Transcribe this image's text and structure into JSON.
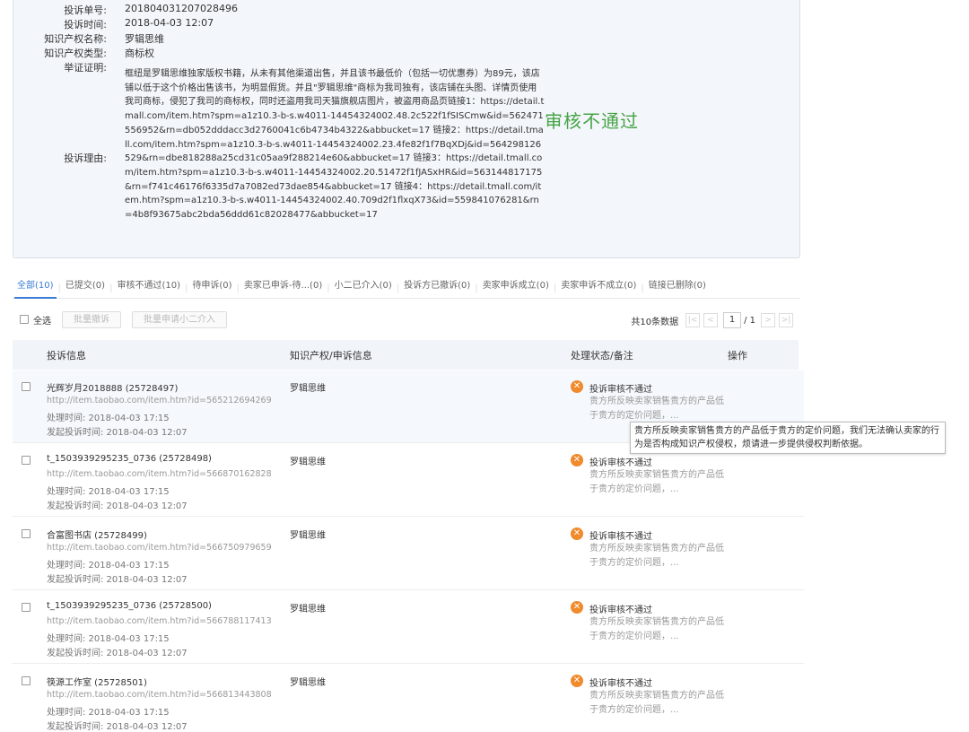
{
  "complaint": {
    "id_label": "投诉单号:",
    "id_value": "201804031207028496",
    "time_label": "投诉时间:",
    "time_value": "2018-04-03 12:07",
    "ip_name_label": "知识产权名称:",
    "ip_name_value": "罗辑思维",
    "ip_type_label": "知识产权类型:",
    "ip_type_value": "商标权",
    "evidence_label": "举证证明:",
    "reason_label": "投诉理由:",
    "reason_text": "框纽是罗辑思维独家版权书籍，从未有其他渠道出售，并且该书最低价（包括一切优惠券）为89元，该店铺以低于这个价格出售该书，为明显假货。并且\"罗辑思维\"商标为我司独有，该店铺在头图、详情页使用我司商标，侵犯了我司的商标权，同时还盗用我司天猫旗舰店图片，被盗用商品页链接1：https://detail.tmall.com/item.htm?spm=a1z10.3-b-s.w4011-14454324002.48.2c522f1fSISCmw&id=562471556952&rn=db052dddacc3d2760041c6b4734b4322&abbucket=17 链接2：https://detail.tmall.com/item.htm?spm=a1z10.3-b-s.w4011-14454324002.23.4fe82f1f7BqXDj&id=564298126529&rn=dbe818288a25cd31c05aa9f288214e60&abbucket=17 链接3：https://detail.tmall.com/item.htm?spm=a1z10.3-b-s.w4011-14454324002.20.51472f1fJASxHR&id=563144817175&rn=f741c46176f6335d7a7082ed73dae854&abbucket=17 链接4：https://detail.tmall.com/item.htm?spm=a1z10.3-b-s.w4011-14454324002.40.709d2f1flxqX73&id=559841076281&rn=4b8f93675abc2bda56ddd61c82028477&abbucket=17",
    "stamp": "审核不通过"
  },
  "tabs": [
    {
      "label": "全部(10)",
      "active": true
    },
    {
      "label": "已提交(0)"
    },
    {
      "label": "审核不通过(10)"
    },
    {
      "label": "待申诉(0)"
    },
    {
      "label": "卖家已申诉-待...(0)"
    },
    {
      "label": "小二已介入(0)"
    },
    {
      "label": "投诉方已撤诉(0)"
    },
    {
      "label": "卖家申诉成立(0)"
    },
    {
      "label": "卖家申诉不成立(0)"
    },
    {
      "label": "链接已删除(0)"
    }
  ],
  "toolbar": {
    "select_all": "全选",
    "batch_withdraw": "批量撤诉",
    "batch_request": "批量申请小二介入"
  },
  "pager": {
    "total_text": "共10条数据",
    "first": "|<",
    "prev": "<",
    "current": "1",
    "total_pages": "/ 1",
    "next": ">",
    "last": ">|"
  },
  "table": {
    "headers": [
      "投诉信息",
      "知识产权/申诉信息",
      "处理状态/备注",
      "操作"
    ],
    "rows": [
      {
        "store": "光辉岁月2018888 (25728497)",
        "url": "http://item.taobao.com/item.htm?id=565212694269",
        "handled": "处理时间:  2018-04-03 17:15",
        "filed": "发起投诉时间:  2018-04-03 12:07",
        "ip": "罗辑思维",
        "status": "投诉审核不通过",
        "note": "贵方所反映卖家销售贵方的产品低于贵方的定价问题，..."
      },
      {
        "store": "t_1503939295235_0736 (25728498)",
        "url": "http://item.taobao.com/item.htm?id=566870162828",
        "handled": "处理时间:  2018-04-03 17:15",
        "filed": "发起投诉时间:  2018-04-03 12:07",
        "ip": "罗辑思维",
        "status": "投诉审核不通过",
        "note": "贵方所反映卖家销售贵方的产品低于贵方的定价问题，..."
      },
      {
        "store": "合富图书店 (25728499)",
        "url": "http://item.taobao.com/item.htm?id=566750979659",
        "handled": "处理时间:  2018-04-03 17:15",
        "filed": "发起投诉时间:  2018-04-03 12:07",
        "ip": "罗辑思维",
        "status": "投诉审核不通过",
        "note": "贵方所反映卖家销售贵方的产品低于贵方的定价问题，..."
      },
      {
        "store": "t_1503939295235_0736 (25728500)",
        "url": "http://item.taobao.com/item.htm?id=566788117413",
        "handled": "处理时间:  2018-04-03 17:15",
        "filed": "发起投诉时间:  2018-04-03 12:07",
        "ip": "罗辑思维",
        "status": "投诉审核不通过",
        "note": "贵方所反映卖家销售贵方的产品低于贵方的定价问题，..."
      },
      {
        "store": "筷源工作室 (25728501)",
        "url": "http://item.taobao.com/item.htm?id=566813443808",
        "handled": "处理时间:  2018-04-03 17:15",
        "filed": "发起投诉时间:  2018-04-03 12:07",
        "ip": "罗辑思维",
        "status": "投诉审核不通过",
        "note": "贵方所反映卖家销售贵方的产品低于贵方的定价问题，..."
      }
    ]
  },
  "tooltip": "贵方所反映卖家销售贵方的产品低于贵方的定价问题，我们无法确认卖家的行为是否构成知识产权侵权，烦请进一步提供侵权判断依据。",
  "colors": {
    "accent": "#3a7bd5",
    "stamp_green": "#47a447",
    "status_orange": "#f08a2a"
  },
  "icons": {
    "status": "close-circle-icon"
  }
}
